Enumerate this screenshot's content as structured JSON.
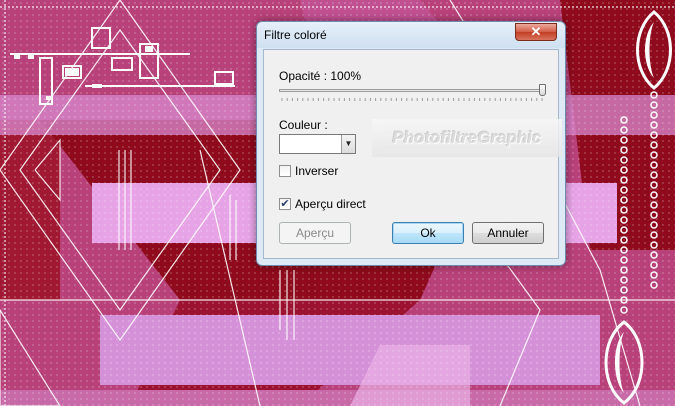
{
  "dialog": {
    "title": "Filtre coloré",
    "close_label": "✕",
    "opacity_label": "Opacité : 100%",
    "opacity_value": 100,
    "color_label": "Couleur :",
    "color_value": "#ffffff",
    "watermark": "PhotofiltreGraphic",
    "invert_label": "Inverser",
    "invert_checked": false,
    "preview_live_label": "Aperçu direct",
    "preview_live_checked": true,
    "preview_button": "Aperçu",
    "ok_button": "Ok",
    "cancel_button": "Annuler"
  },
  "icons": {
    "close": "close-icon",
    "dropdown": "chevron-down-icon",
    "check": "checkmark-icon"
  },
  "colors": {
    "canvas_pink": "#b8417a",
    "canvas_dark_red": "#8e0a1c",
    "canvas_light_violet": "#e6a3e6",
    "dialog_frame": "#dde9f5"
  }
}
